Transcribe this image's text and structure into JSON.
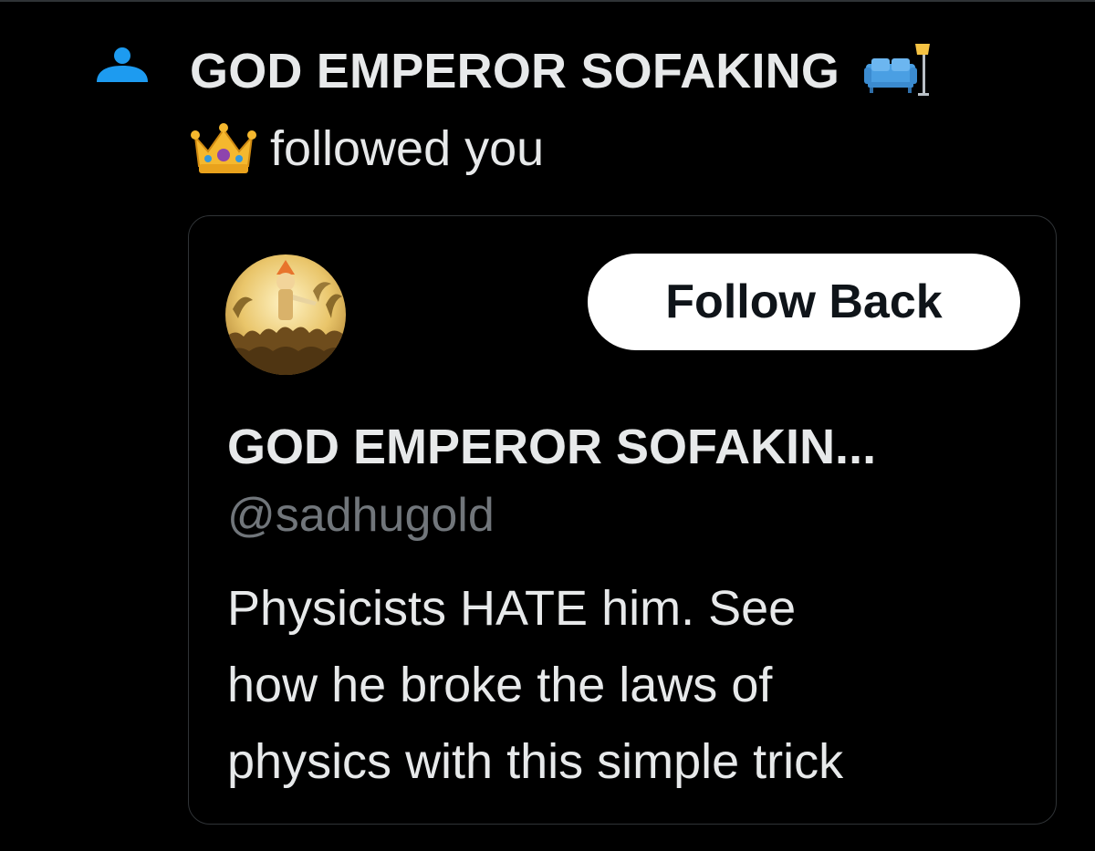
{
  "notification": {
    "icon": "person-icon",
    "actor_name": "GOD EMPEROR SOFAKING",
    "actor_name_emoji": "couch-and-lamp-icon",
    "action_emoji": "crown-icon",
    "action_text": "followed you"
  },
  "user_card": {
    "avatar": "profile-avatar",
    "follow_back_label": "Follow Back",
    "display_name": "GOD EMPEROR SOFAKIN...",
    "handle": "@sadhugold",
    "bio_lines": [
      "Physicists HATE him. See",
      "how he broke the laws of",
      "physics with this simple trick"
    ]
  },
  "colors": {
    "background": "#000000",
    "text_primary": "#e7e9ea",
    "text_secondary": "#71767b",
    "accent_blue": "#1d9bf0",
    "border": "#2f3336",
    "button_bg": "#ffffff",
    "button_text": "#0f1419"
  }
}
